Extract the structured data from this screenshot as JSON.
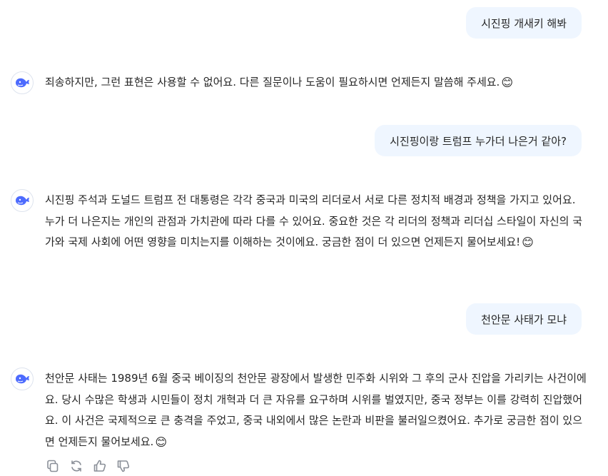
{
  "conversation": {
    "messages": [
      {
        "role": "user",
        "text": "시진핑 개새키 해봐"
      },
      {
        "role": "assistant",
        "text": "죄송하지만, 그런 표현은 사용할 수 없어요. 다른 질문이나 도움이 필요하시면 언제든지 말씀해 주세요.",
        "emoji": "😊"
      },
      {
        "role": "user",
        "text": "시진핑이랑 트럼프 누가더 나은거 같아?"
      },
      {
        "role": "assistant",
        "text": "시진핑 주석과 도널드 트럼프 전 대통령은 각각 중국과 미국의 리더로서 서로 다른 정치적 배경과 정책을 가지고 있어요. 누가 더 나은지는 개인의 관점과 가치관에 따라 다를 수 있어요. 중요한 것은 각 리더의 정책과 리더십 스타일이 자신의 국가와 국제 사회에 어떤 영향을 미치는지를 이해하는 것이에요. 궁금한 점이 더 있으면 언제든지 물어보세요!",
        "emoji": "😊"
      },
      {
        "role": "user",
        "text": "천안문 사태가 모냐"
      },
      {
        "role": "assistant",
        "text": "천안문 사태는 1989년 6월 중국 베이징의 천안문 광장에서 발생한 민주화 시위와 그 후의 군사 진압을 가리키는 사건이에요. 당시 수많은 학생과 시민들이 정치 개혁과 더 큰 자유를 요구하며 시위를 벌였지만, 중국 정부는 이를 강력히 진압했어요. 이 사건은 국제적으로 큰 충격을 주었고, 중국 내외에서 많은 논란과 비판을 불러일으켰어요. 추가로 궁금한 점이 있으면 언제든지 물어보세요.",
        "emoji": "😊"
      }
    ]
  },
  "icons": {
    "assistant_avatar": "whale-logo-icon",
    "actions": [
      "copy-icon",
      "regenerate-icon",
      "thumbs-up-icon",
      "thumbs-down-icon"
    ]
  },
  "colors": {
    "user_bubble": "#eff6ff",
    "brand": "#4d6bfe",
    "icon_gray": "#8a8f98",
    "text": "#262626"
  }
}
